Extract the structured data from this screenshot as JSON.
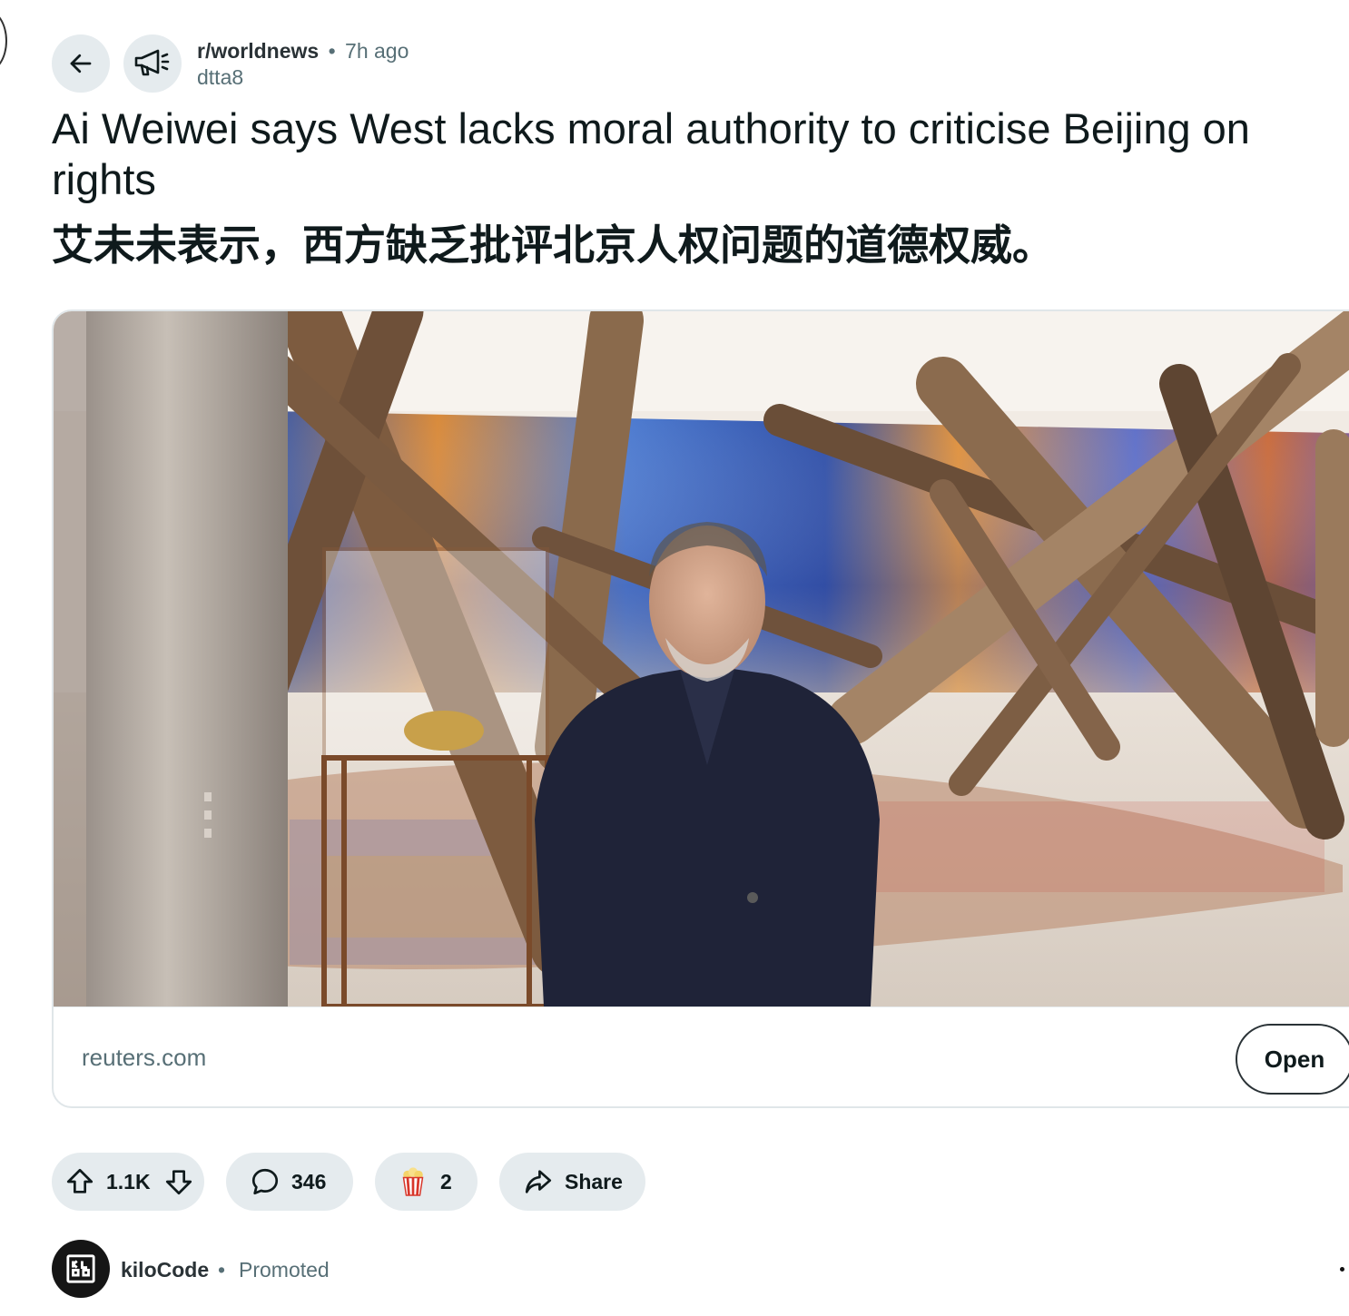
{
  "post": {
    "subreddit": "r/worldnews",
    "separator": "•",
    "time_ago": "7h ago",
    "author": "dtta8",
    "title": "Ai Weiwei says West lacks moral authority to criticise Beijing on rights",
    "title_translation": "艾未未表示，西方缺乏批评北京人权问题的道德权威。"
  },
  "link_card": {
    "domain": "reuters.com",
    "open_label": "Open"
  },
  "actions": {
    "vote_count": "1.1K",
    "comment_count": "346",
    "award_count": "2",
    "share_label": "Share"
  },
  "promoted": {
    "name": "kiloCode",
    "separator": "•",
    "label": "Promoted"
  },
  "icons": {
    "back": "arrow-left-icon",
    "subreddit": "megaphone-icon",
    "upvote": "arrow-up-icon",
    "downvote": "arrow-down-icon",
    "comment": "speech-bubble-icon",
    "award": "popcorn-icon",
    "share": "share-arrow-icon",
    "more": "more-options-icon"
  }
}
